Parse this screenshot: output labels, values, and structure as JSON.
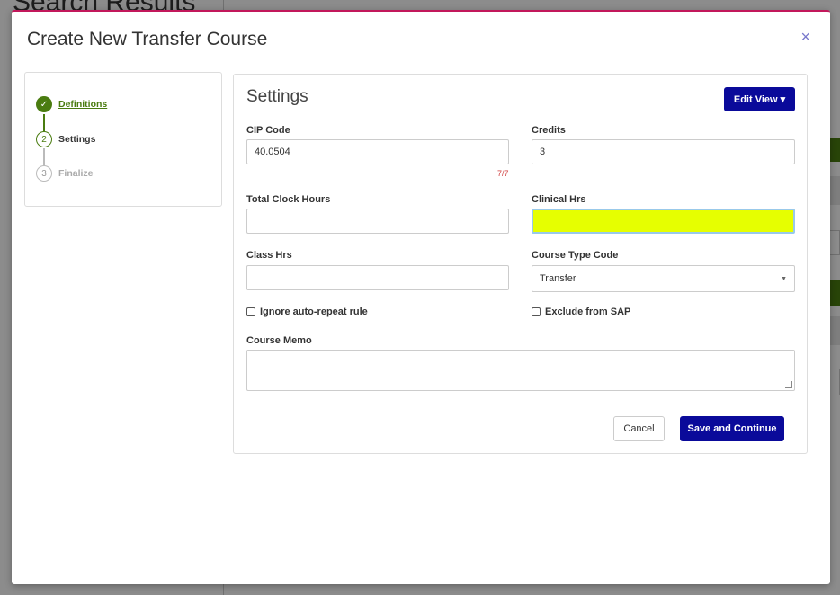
{
  "background": {
    "title": "Search Results"
  },
  "modal": {
    "title": "Create New Transfer Course",
    "close_icon": "×"
  },
  "stepper": {
    "steps": [
      {
        "number": "✓",
        "label": "Definitions",
        "state": "done"
      },
      {
        "number": "2",
        "label": "Settings",
        "state": "active"
      },
      {
        "number": "3",
        "label": "Finalize",
        "state": "pending"
      }
    ]
  },
  "settings": {
    "title": "Settings",
    "edit_view_label": "Edit View ▾",
    "cip_code": {
      "label": "CIP Code",
      "value": "40.0504",
      "counter": "7/7"
    },
    "credits": {
      "label": "Credits",
      "value": "3"
    },
    "total_clock_hours": {
      "label": "Total Clock Hours",
      "value": ""
    },
    "clinical_hrs": {
      "label": "Clinical Hrs",
      "value": ""
    },
    "class_hrs": {
      "label": "Class Hrs",
      "value": ""
    },
    "course_type_code": {
      "label": "Course Type Code",
      "value": "Transfer"
    },
    "ignore_auto_repeat": {
      "label": "Ignore auto-repeat rule",
      "checked": false
    },
    "exclude_from_sap": {
      "label": "Exclude from SAP",
      "checked": false
    },
    "course_memo": {
      "label": "Course Memo",
      "value": ""
    },
    "cancel_label": "Cancel",
    "save_label": "Save and Continue"
  },
  "colors": {
    "accent": "#0a0a9a",
    "success": "#4a7c10",
    "highlight": "#e6ff00",
    "modal_border": "#c2185b"
  }
}
